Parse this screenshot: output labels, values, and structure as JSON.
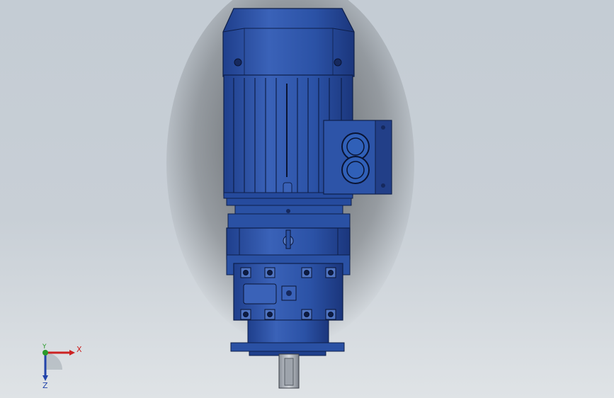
{
  "viewport": {
    "background_top": "#c4ccd4",
    "background_bottom": "#dfe3e6"
  },
  "model": {
    "name": "gear-motor",
    "body_color": "#2f55a8",
    "shadow_color": "#1a2f66"
  },
  "triad": {
    "x_label": "X",
    "y_label": "Y",
    "z_label": "Z",
    "x_color": "#cc2222",
    "y_color": "#2a9a2a",
    "z_color": "#2244aa"
  }
}
